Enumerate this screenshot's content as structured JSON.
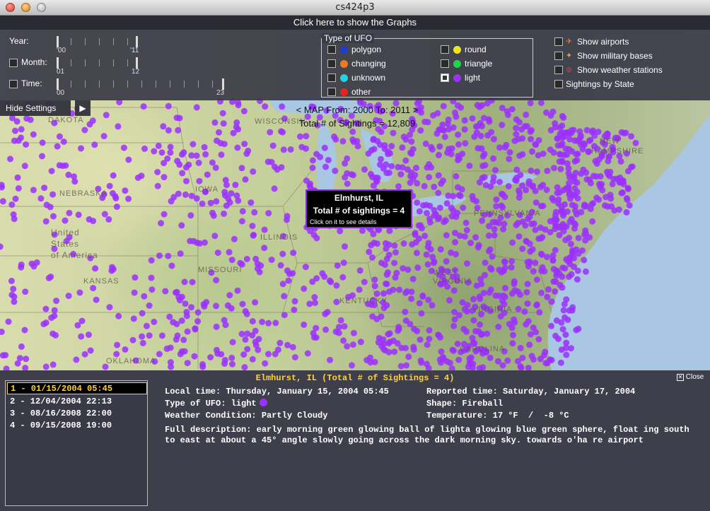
{
  "window": {
    "title": "cs424p3"
  },
  "graph_bar": {
    "label": "Click here to show the Graphs"
  },
  "settings": {
    "year": {
      "label": "Year:",
      "min": "'00",
      "max": "'11"
    },
    "month": {
      "label": "Month:",
      "min": "01",
      "max": "12"
    },
    "time": {
      "label": "Time:",
      "min": "00",
      "max": "23"
    },
    "ufo_types": {
      "legend": "Type of UFO",
      "items": [
        {
          "label": "polygon",
          "color": "#1f3bd6",
          "checked": false
        },
        {
          "label": "changing",
          "color": "#f07a1a",
          "checked": false
        },
        {
          "label": "unknown",
          "color": "#19d6e6",
          "checked": false
        },
        {
          "label": "other",
          "color": "#e8231d",
          "checked": false
        },
        {
          "label": "round",
          "color": "#f2e41e",
          "checked": false
        },
        {
          "label": "triangle",
          "color": "#1ad650",
          "checked": false
        },
        {
          "label": "light",
          "color": "#9b30ff",
          "checked": true
        }
      ]
    },
    "options": [
      {
        "label": "Show airports",
        "icon": "airport-icon"
      },
      {
        "label": "Show military bases",
        "icon": "military-icon"
      },
      {
        "label": "Show weather stations",
        "icon": "weather-icon"
      },
      {
        "label": "Sightings by State",
        "icon": ""
      }
    ],
    "hide_label": "Hide Settings",
    "hide_arrow": "▶"
  },
  "map": {
    "range_label": "< MAP From: 2000 To: 2011 >",
    "total_label": "Total # of Sightings = 12,809",
    "marker_color": "#9b30ff",
    "state_labels": [
      "DAKOTA",
      "NEBRASKA",
      "United",
      "States",
      "of America",
      "KANSAS",
      "OKLAHOMA",
      "IOWA",
      "ILLINOIS",
      "MISSOURI",
      "KENTUCKY",
      "WEST",
      "VIRGINIA",
      "VIRGINIA",
      "PENNSYLVANIA",
      "NEW",
      "HAMPSHIRE",
      "WISCONSIN",
      "CAROLINA"
    ]
  },
  "tooltip": {
    "city": "Elmhurst, IL",
    "count": "Total # of sightings = 4",
    "hint": "Click on it to see details"
  },
  "details": {
    "header": "Elmhurst, IL (Total # of Sightings = 4)",
    "close_label": "Close",
    "sightings": [
      "1 - 01/15/2004 05:45",
      "2 - 12/04/2004 22:13",
      "3 - 08/16/2008 22:00",
      "4 - 09/15/2008 19:00"
    ],
    "local_time": "Local time: Thursday, January 15, 2004 05:45",
    "reported_time": "Reported time: Saturday, January 17, 2004",
    "ufo_type": "Type of UFO: light",
    "shape": "Shape: Fireball",
    "weather": "Weather Condition: Partly Cloudy",
    "temperature": "Temperature: 17 °F  /  -8 °C",
    "description": "Full description: early morning green glowing ball of lighta glowing blue green sphere, float ing south to east at about a 45° angle slowly going across the dark morning sky. towards o'ha re airport"
  }
}
